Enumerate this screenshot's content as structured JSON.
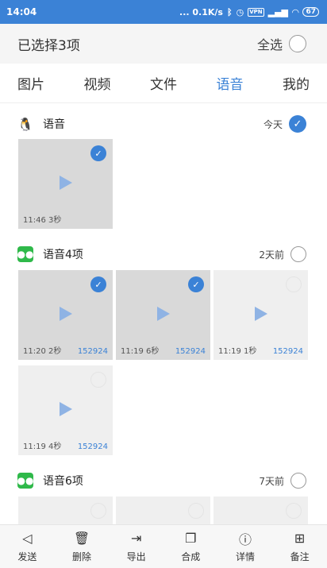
{
  "status_bar": {
    "time": "14:04",
    "network_speed": "... 0.1K/s",
    "vpn": "VPN",
    "battery": "67"
  },
  "header": {
    "title": "已选择3项",
    "select_all_label": "全选"
  },
  "tabs": [
    {
      "label": "图片"
    },
    {
      "label": "视频"
    },
    {
      "label": "文件"
    },
    {
      "label": "语音",
      "active": true
    },
    {
      "label": "我的"
    }
  ],
  "sections": [
    {
      "title": "语音",
      "date": "今天",
      "selected": true,
      "items": [
        {
          "info": "11:46 3秒",
          "selected": true
        }
      ]
    },
    {
      "title": "语音4项",
      "date": "2天前",
      "selected": false,
      "items": [
        {
          "info": "11:20 2秒",
          "number": "152924",
          "selected": true
        },
        {
          "info": "11:19 6秒",
          "number": "152924",
          "selected": true
        },
        {
          "info": "11:19 1秒",
          "number": "152924",
          "selected": false
        },
        {
          "info": "11:19 4秒",
          "number": "152924",
          "selected": false
        }
      ]
    },
    {
      "title": "语音6项",
      "date": "7天前",
      "selected": false,
      "items": []
    }
  ],
  "toolbar": [
    {
      "label": "发送",
      "icon": "send-icon"
    },
    {
      "label": "删除",
      "icon": "delete-icon"
    },
    {
      "label": "导出",
      "icon": "export-icon"
    },
    {
      "label": "合成",
      "icon": "merge-icon"
    },
    {
      "label": "详情",
      "icon": "info-icon"
    },
    {
      "label": "备注",
      "icon": "note-icon"
    }
  ],
  "colors": {
    "accent": "#3b82d6",
    "wechat": "#2fb94a"
  }
}
